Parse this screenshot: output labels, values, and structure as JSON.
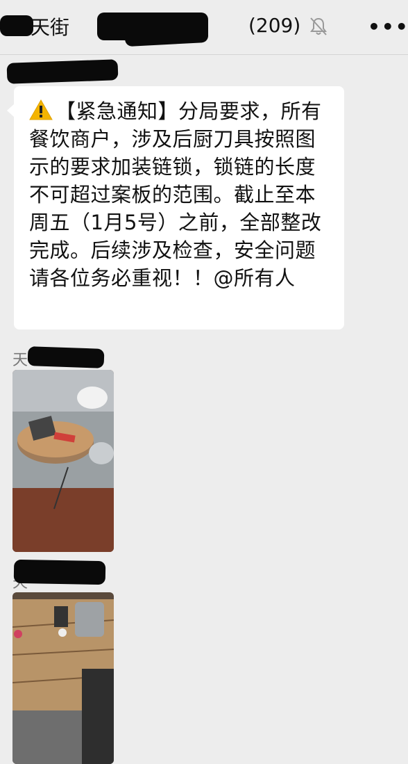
{
  "header": {
    "title_visible_start": "天街",
    "title_ellipsis": "…",
    "member_count": "(209)",
    "mute_icon": "bell-off-icon",
    "more_icon": "more-dots-icon",
    "more_label": "•••"
  },
  "message": {
    "warning_icon": "warning-icon",
    "text": "【紧急通知】分局要求，所有餐饮商户，涉及后厨刀具按照图示的要求加装链锁，锁链的长度不可超过案板的范围。截止至本周五（1月5号）之前，全部整改完成。后续涉及检查，安全问题请各位务必重视！！@所有人"
  },
  "posts": [
    {
      "sender_visible": "天",
      "image": "kitchen-chopping-board-photo-1"
    },
    {
      "sender_visible": "天",
      "image": "kitchen-chopping-board-photo-2"
    }
  ]
}
